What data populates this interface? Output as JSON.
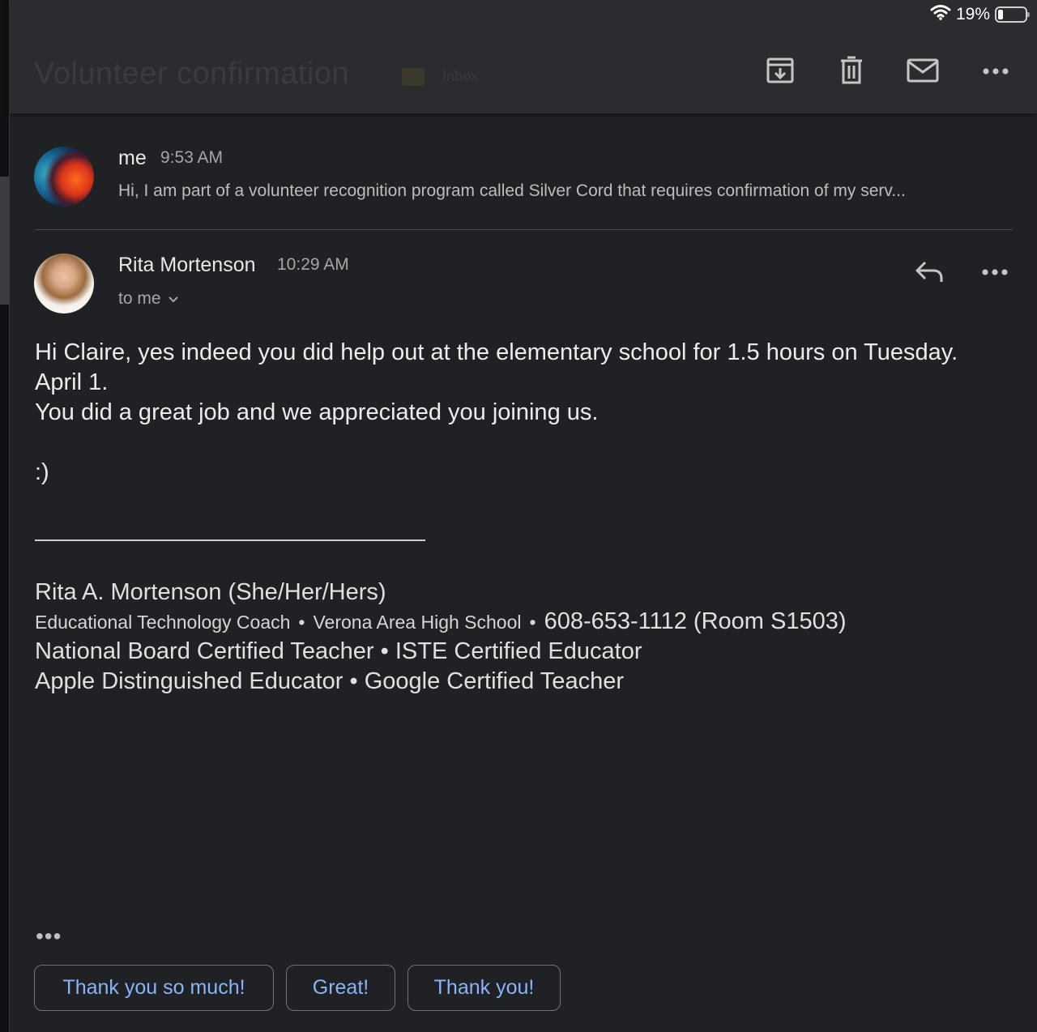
{
  "status_bar": {
    "battery_percent_label": "19%",
    "battery_level": 0.19,
    "wifi_icon": "wifi-icon"
  },
  "header": {
    "subject": "Volunteer confirmation",
    "subject_label": "Inbox",
    "actions": {
      "archive_icon": "archive-icon",
      "delete_icon": "trash-icon",
      "mark_unread_icon": "mail-icon",
      "more_icon": "more-horizontal-icon"
    }
  },
  "messages": [
    {
      "sender": "me",
      "time": "9:53 AM",
      "snippet": "Hi, I am part of a volunteer recognition program called Silver Cord that requires confirmation of my serv...",
      "avatar_icon": "planet-avatar"
    },
    {
      "sender": "Rita Mortenson",
      "time": "10:29 AM",
      "recipients_label": "to me",
      "avatar_icon": "profile-photo-avatar",
      "body_lines": [
        "Hi Claire, yes indeed you did help out at the elementary school for 1.5 hours on Tuesday.",
        "April 1.",
        "You did a great job and we appreciated you joining us.",
        ":)"
      ],
      "signature": {
        "name": "Rita A. Mortenson (She/Her/Hers)",
        "role_part1": "Educational Technology Coach",
        "role_part2": "Verona Area High School",
        "phone": "608-653-1112 (Room S1503)",
        "line3": "National Board Certified Teacher • ISTE Certified Educator",
        "line4": "Apple Distinguished Educator • Google Certified Teacher",
        "separator": "•"
      },
      "quoted_toggle": "•••"
    }
  ],
  "smart_replies": [
    "Thank you so much!",
    "Great!",
    "Thank you!"
  ],
  "colors": {
    "background": "#202124",
    "toolbar": "#2b2c30",
    "accent_link": "#8ab4f8"
  }
}
